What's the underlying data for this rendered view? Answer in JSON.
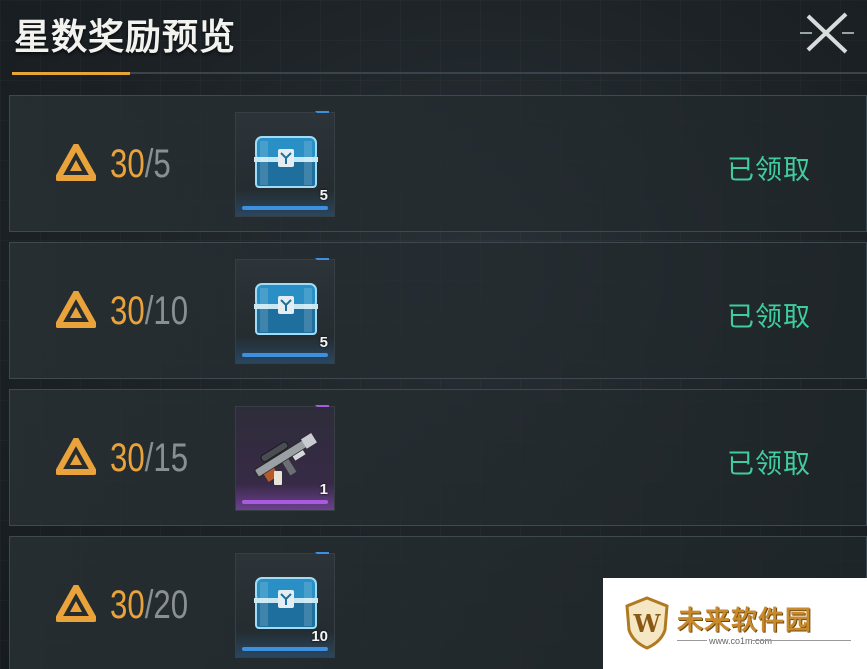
{
  "header": {
    "title": "星数奖励预览",
    "close_icon": "close-x-icon"
  },
  "colors": {
    "accent_orange": "#e9a33a",
    "status_green": "#3fcd9e",
    "rarity_blue": "#3d8fe0",
    "rarity_purple": "#a95be0"
  },
  "rewards": [
    {
      "current": "30",
      "sep": "/",
      "required": "5",
      "item_icon": "blue-chest-icon",
      "rarity": "blue",
      "count": "5",
      "status": "已领取"
    },
    {
      "current": "30",
      "sep": "/",
      "required": "10",
      "item_icon": "blue-chest-icon",
      "rarity": "blue",
      "count": "5",
      "status": "已领取"
    },
    {
      "current": "30",
      "sep": "/",
      "required": "15",
      "item_icon": "rifle-icon",
      "rarity": "purple",
      "count": "1",
      "status": "已领取"
    },
    {
      "current": "30",
      "sep": "/",
      "required": "20",
      "item_icon": "blue-chest-icon",
      "rarity": "blue",
      "count": "10",
      "status": ""
    }
  ],
  "watermark": {
    "text": "未来软件园",
    "url": "www.co1m.com",
    "logo_letter": "W"
  }
}
